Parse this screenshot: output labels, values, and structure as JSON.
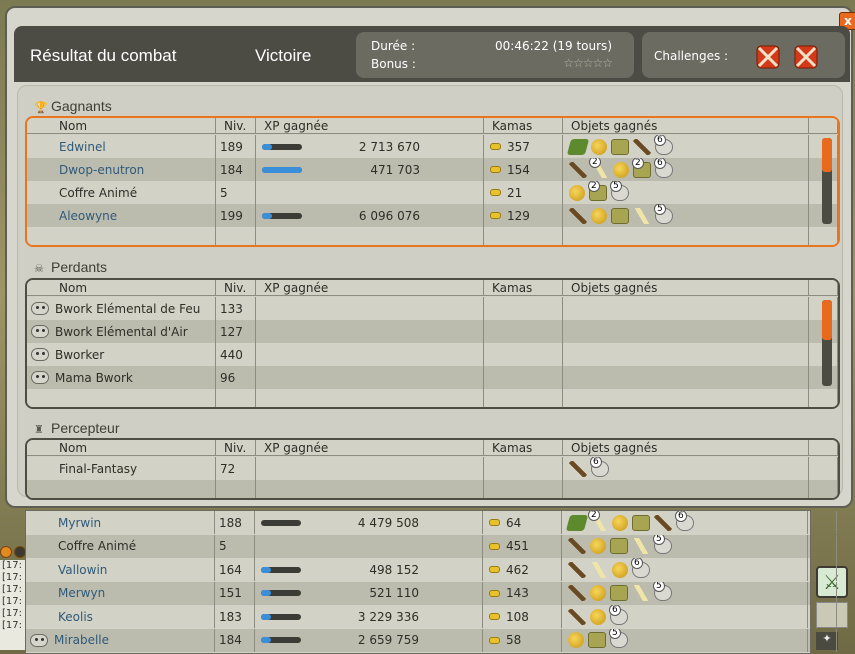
{
  "window": {
    "title": "Résultat du combat",
    "result": "Victoire",
    "duration_label": "Durée :",
    "duration_value": "00:46:22 (19 tours)",
    "bonus_label": "Bonus :",
    "bonus_stars": "☆☆☆☆☆",
    "challenges_label": "Challenges :",
    "close_label": "x"
  },
  "columns": {
    "name": "Nom",
    "level": "Niv.",
    "xp": "XP gagnée",
    "kamas": "Kamas",
    "items": "Objets gagnés"
  },
  "winners": {
    "title": "Gagnants",
    "rows": [
      {
        "name": "Edwinel",
        "level": "189",
        "xp": "2 713 670",
        "xp_fill": 0.25,
        "kamas": "357",
        "link": true,
        "items": [
          {
            "icon": "leaf"
          },
          {
            "icon": "gold"
          },
          {
            "icon": "map"
          },
          {
            "icon": "twig"
          },
          {
            "icon": "skull",
            "qty": "6"
          }
        ]
      },
      {
        "name": "Dwop-enutron",
        "level": "184",
        "xp": "471 703",
        "xp_fill": 1.0,
        "kamas": "154",
        "link": true,
        "items": [
          {
            "icon": "twig"
          },
          {
            "icon": "feather",
            "qty": "2"
          },
          {
            "icon": "gold"
          },
          {
            "icon": "map",
            "qty": "2"
          },
          {
            "icon": "skull",
            "qty": "6"
          }
        ]
      },
      {
        "name": "Coffre Animé",
        "level": "5",
        "xp": "",
        "xp_fill": null,
        "kamas": "21",
        "link": false,
        "items": [
          {
            "icon": "gold"
          },
          {
            "icon": "map",
            "qty": "2"
          },
          {
            "icon": "skull",
            "qty": "5"
          }
        ]
      },
      {
        "name": "Aleowyne",
        "level": "199",
        "xp": "6 096 076",
        "xp_fill": 0.25,
        "kamas": "129",
        "link": true,
        "items": [
          {
            "icon": "twig"
          },
          {
            "icon": "gold"
          },
          {
            "icon": "map"
          },
          {
            "icon": "feather"
          },
          {
            "icon": "skull",
            "qty": "5"
          }
        ]
      }
    ]
  },
  "losers": {
    "title": "Perdants",
    "rows": [
      {
        "name": "Bwork Elémental de Feu",
        "level": "133"
      },
      {
        "name": "Bwork Elémental d'Air",
        "level": "127"
      },
      {
        "name": "Bworker",
        "level": "440"
      },
      {
        "name": "Mama Bwork",
        "level": "96"
      }
    ]
  },
  "collector": {
    "title": "Percepteur",
    "rows": [
      {
        "name": "Final-Fantasy",
        "level": "72",
        "items": [
          {
            "icon": "twig"
          },
          {
            "icon": "skull",
            "qty": "6"
          }
        ]
      }
    ]
  },
  "overflow_rows": [
    {
      "name": "Myrwin",
      "level": "188",
      "xp": "4 479 508",
      "xp_fill": 0.0,
      "kamas": "64",
      "link": true,
      "skull": false,
      "items": [
        {
          "icon": "leaf"
        },
        {
          "icon": "feather",
          "qty": "2"
        },
        {
          "icon": "gold"
        },
        {
          "icon": "map"
        },
        {
          "icon": "twig"
        },
        {
          "icon": "skull",
          "qty": "6"
        }
      ]
    },
    {
      "name": "Coffre Animé",
      "level": "5",
      "xp": "",
      "xp_fill": null,
      "kamas": "451",
      "link": false,
      "skull": false,
      "items": [
        {
          "icon": "twig"
        },
        {
          "icon": "gold"
        },
        {
          "icon": "map"
        },
        {
          "icon": "feather"
        },
        {
          "icon": "skull",
          "qty": "5"
        }
      ]
    },
    {
      "name": "Vallowin",
      "level": "164",
      "xp": "498 152",
      "xp_fill": 0.25,
      "kamas": "462",
      "link": true,
      "skull": false,
      "items": [
        {
          "icon": "twig"
        },
        {
          "icon": "feather"
        },
        {
          "icon": "gold"
        },
        {
          "icon": "skull",
          "qty": "6"
        }
      ]
    },
    {
      "name": "Merwyn",
      "level": "151",
      "xp": "521 110",
      "xp_fill": 0.25,
      "kamas": "143",
      "link": true,
      "skull": false,
      "items": [
        {
          "icon": "twig"
        },
        {
          "icon": "gold"
        },
        {
          "icon": "map"
        },
        {
          "icon": "feather"
        },
        {
          "icon": "skull",
          "qty": "5"
        }
      ]
    },
    {
      "name": "Keolis",
      "level": "183",
      "xp": "3 229 336",
      "xp_fill": 0.25,
      "kamas": "108",
      "link": true,
      "skull": false,
      "items": [
        {
          "icon": "twig"
        },
        {
          "icon": "gold"
        },
        {
          "icon": "skull",
          "qty": "6"
        }
      ]
    },
    {
      "name": "Mirabelle",
      "level": "184",
      "xp": "2 659 759",
      "xp_fill": 0.25,
      "kamas": "58",
      "link": true,
      "skull": true,
      "items": [
        {
          "icon": "gold"
        },
        {
          "icon": "map"
        },
        {
          "icon": "skull",
          "qty": "5"
        }
      ]
    }
  ],
  "chat": {
    "lines": [
      "[17:",
      "[17:",
      "[17:",
      "[17:",
      "[17:",
      "[17:"
    ]
  }
}
